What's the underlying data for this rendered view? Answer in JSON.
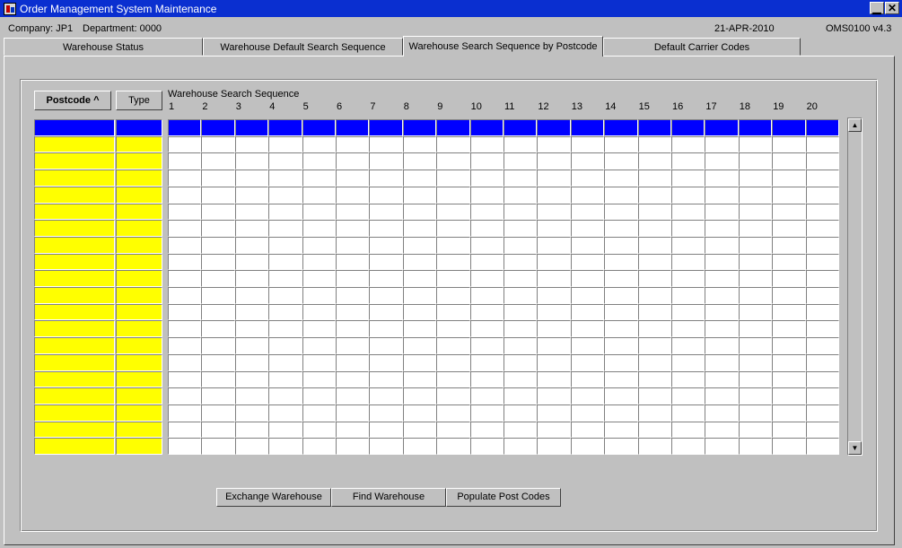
{
  "window": {
    "title": "Order Management System Maintenance",
    "minimize_glyph": "▁",
    "close_glyph": "✕"
  },
  "status": {
    "company": "Company:  JP1",
    "department": "Department:  0000",
    "date": "21-APR-2010",
    "version": "OMS0100  v4.3"
  },
  "tabs": [
    {
      "label": "Warehouse Status",
      "active": false
    },
    {
      "label": "Warehouse Default Search Sequence",
      "active": false
    },
    {
      "label": "Warehouse Search Sequence by Postcode",
      "active": true
    },
    {
      "label": "Default Carrier Codes",
      "active": false
    }
  ],
  "grid": {
    "postcode_header": "Postcode ^",
    "type_header": "Type",
    "sequence_title": "Warehouse Search Sequence",
    "column_numbers": [
      "1",
      "2",
      "3",
      "4",
      "5",
      "6",
      "7",
      "8",
      "9",
      "10",
      "11",
      "12",
      "13",
      "14",
      "15",
      "16",
      "17",
      "18",
      "19",
      "20"
    ],
    "row_count": 19,
    "colors": {
      "key_cells": "#ffff00",
      "current_row": "#0000ff",
      "data_cells": "#ffffff"
    }
  },
  "scrollbar": {
    "up_glyph": "▲",
    "down_glyph": "▼"
  },
  "actions": {
    "exchange": "Exchange Warehouse",
    "find": "Find Warehouse",
    "populate": "Populate Post Codes"
  },
  "icons": {
    "app": "oracle-forms-app-icon"
  }
}
